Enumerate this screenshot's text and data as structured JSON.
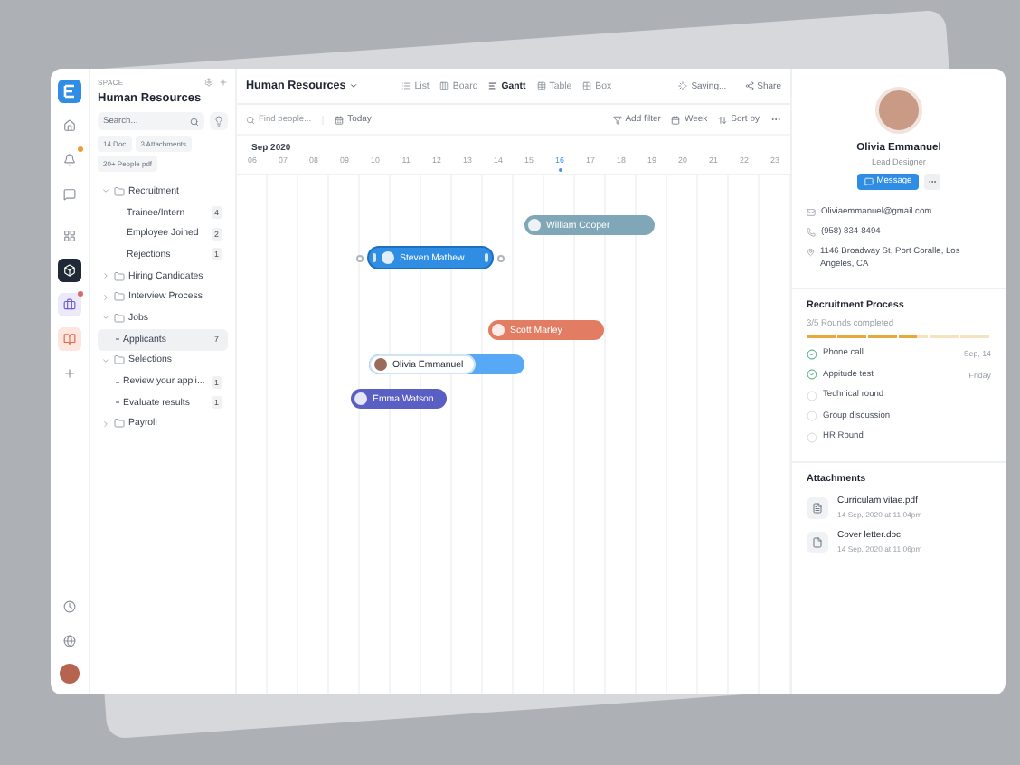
{
  "sidebar": {
    "space_label": "SPACE",
    "title": "Human Resources",
    "search": {
      "placeholder": "Search..."
    },
    "chips": [
      "14 Doc",
      "3 Attachments",
      "20+ People pdf"
    ],
    "tree": [
      {
        "label": "Recruitment",
        "expanded": true,
        "children": [
          {
            "label": "Trainee/Intern",
            "count": "4",
            "selected": false,
            "bullet": false
          },
          {
            "label": "Employee Joined",
            "count": "2",
            "selected": false,
            "bullet": false
          },
          {
            "label": "Rejections",
            "count": "1",
            "selected": false,
            "bullet": false
          }
        ]
      },
      {
        "label": "Hiring Candidates",
        "expanded": false
      },
      {
        "label": "Interview Process",
        "expanded": false
      },
      {
        "label": "Jobs",
        "expanded": true,
        "children": [
          {
            "label": "Applicants",
            "count": "7",
            "selected": true,
            "bullet": true
          }
        ]
      },
      {
        "label": "Selections",
        "expanded": true,
        "children": [
          {
            "label": "Review your appli...",
            "count": "1",
            "selected": false,
            "bullet": true
          },
          {
            "label": "Evaluate results",
            "count": "1",
            "selected": false,
            "bullet": true
          }
        ]
      },
      {
        "label": "Payroll",
        "expanded": false
      }
    ]
  },
  "toolbar": {
    "title": "Human Resources",
    "views": [
      {
        "label": "List",
        "selected": false
      },
      {
        "label": "Board",
        "selected": false
      },
      {
        "label": "Gantt",
        "selected": true
      },
      {
        "label": "Table",
        "selected": false
      },
      {
        "label": "Box",
        "selected": false
      }
    ],
    "saving": "Saving...",
    "share": "Share"
  },
  "filters": {
    "search": {
      "placeholder": "Find people..."
    },
    "today": "Today",
    "add_filter": "Add filter",
    "week": "Week",
    "sort": "Sort by"
  },
  "gantt": {
    "month": "Sep 2020",
    "days": [
      {
        "label": "06",
        "today": false
      },
      {
        "label": "07",
        "today": false
      },
      {
        "label": "08",
        "today": false
      },
      {
        "label": "09",
        "today": false
      },
      {
        "label": "10",
        "today": false
      },
      {
        "label": "11",
        "today": false
      },
      {
        "label": "12",
        "today": false
      },
      {
        "label": "13",
        "today": false
      },
      {
        "label": "14",
        "today": false
      },
      {
        "label": "15",
        "today": false
      },
      {
        "label": "16",
        "today": true
      },
      {
        "label": "17",
        "today": false
      },
      {
        "label": "18",
        "today": false
      },
      {
        "label": "19",
        "today": false
      },
      {
        "label": "20",
        "today": false
      },
      {
        "label": "21",
        "today": false
      },
      {
        "label": "22",
        "today": false
      },
      {
        "label": "23",
        "today": false
      }
    ],
    "bars": [
      {
        "name": "William Cooper",
        "color": "#7fa7b8",
        "kind": "plain"
      },
      {
        "name": "Steven Mathew",
        "color": "#2f8de4",
        "kind": "resizing"
      },
      {
        "name": "Scott Marley",
        "color": "#e27d64",
        "kind": "plain"
      },
      {
        "name": "Olivia Emmanuel",
        "color": "#58a9f5",
        "kind": "split"
      },
      {
        "name": "Emma Watson",
        "color": "#5a5fc4",
        "kind": "plain"
      }
    ]
  },
  "profile": {
    "name": "Olivia Emmanuel",
    "role": "Lead Designer",
    "message": "Message",
    "email": "Oliviaemmanuel@gmail.com",
    "phone": "(958) 834-8494",
    "address": "1146 Broadway St, Port Coralle, Los Angeles, CA"
  },
  "process": {
    "title": "Recruitment Process",
    "summary": "3/5 Rounds completed",
    "level": 0.6,
    "steps": [
      {
        "label": "Phone call",
        "date": "Sep, 14",
        "checked": true
      },
      {
        "label": "Appitude test",
        "date": "Friday",
        "checked": true
      },
      {
        "label": "Technical round",
        "checked": false
      },
      {
        "label": "Group discussion",
        "checked": false
      },
      {
        "label": "HR Round",
        "checked": false
      }
    ]
  },
  "attachments": {
    "title": "Attachments",
    "files": [
      {
        "name": "Curriculam vitae.pdf",
        "date": "14 Sep, 2020 at 11:04pm"
      },
      {
        "name": "Cover letter.doc",
        "date": "14 Sep, 2020 at 11:06pm"
      }
    ]
  }
}
